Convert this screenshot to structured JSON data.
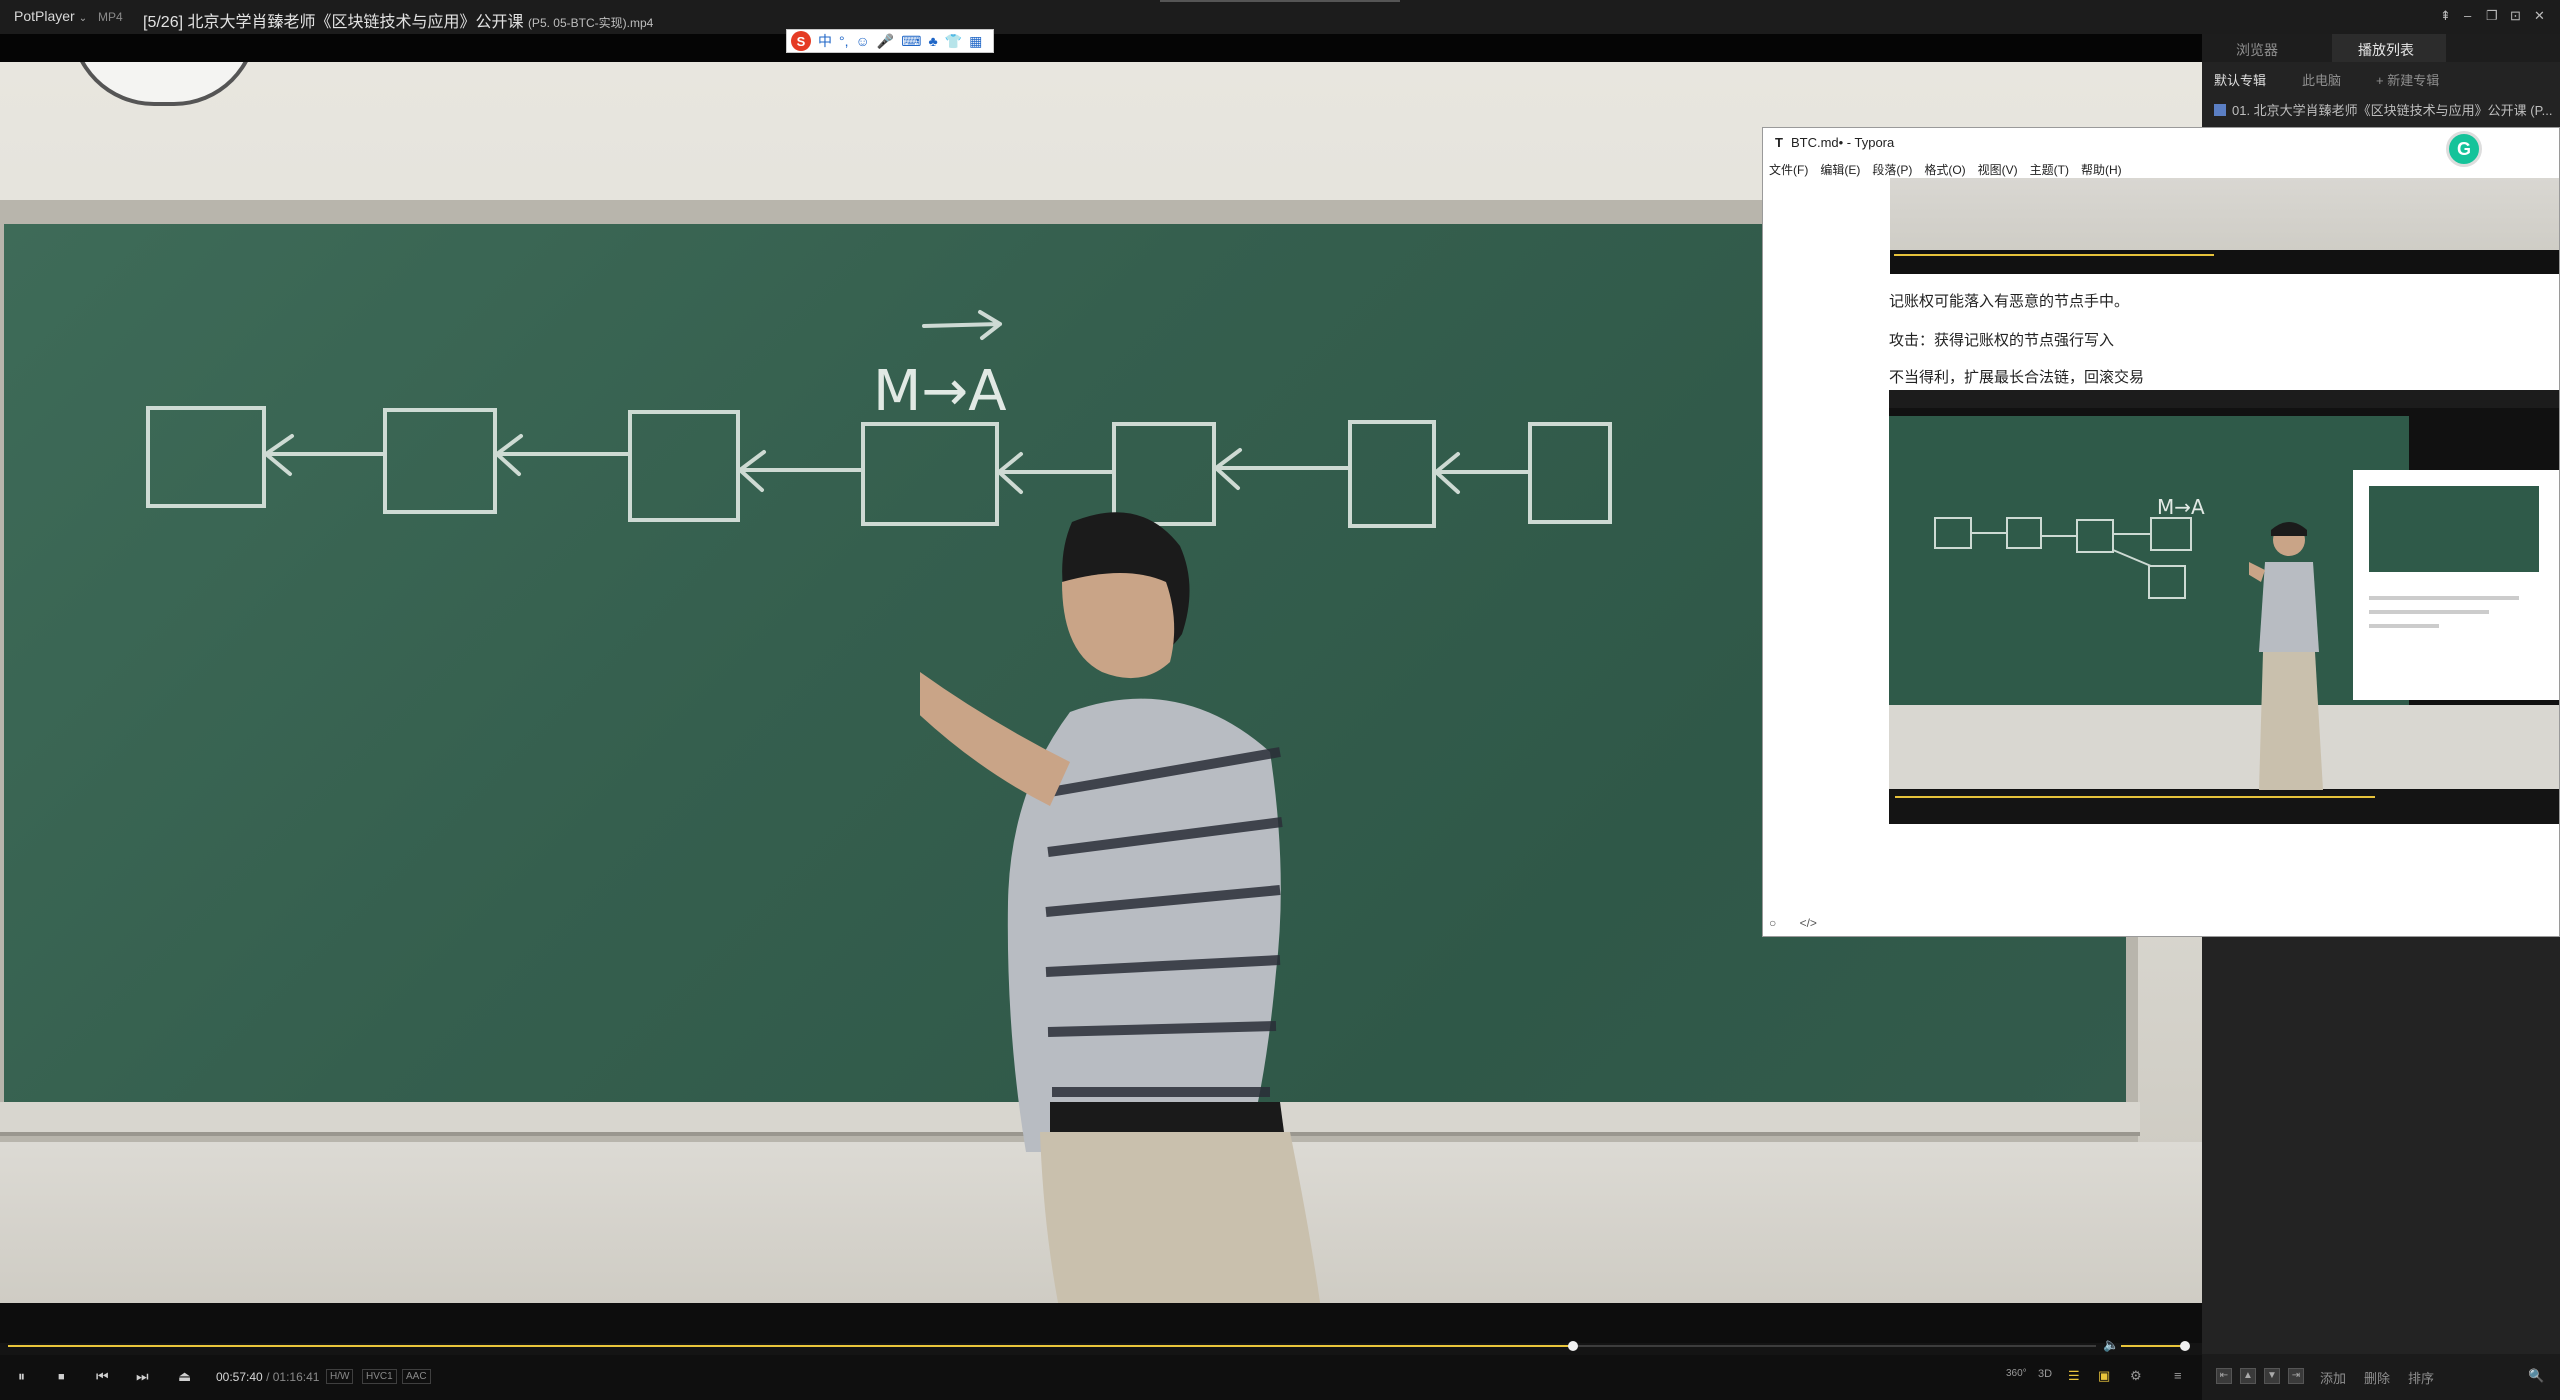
{
  "player": {
    "brand": "PotPlayer",
    "brand_caret": "⌄",
    "format": "MP4",
    "title": "[5/26] 北京大学肖臻老师《区块链技术与应用》公开课",
    "title_sub": "(P5. 05-BTC-实现).mp4",
    "window_controls": [
      "⇞",
      "–",
      "❐",
      "⊡",
      "✕"
    ]
  },
  "ime": {
    "logo": "S",
    "items": [
      "中",
      "°,",
      "☺",
      "🎤",
      "⌨",
      "♣",
      "👕",
      "▦"
    ]
  },
  "video": {
    "board_text": "M→A"
  },
  "typora": {
    "icon": "T",
    "title": "BTC.md• - Typora",
    "menu": [
      "文件(F)",
      "编辑(E)",
      "段落(P)",
      "格式(O)",
      "视图(V)",
      "主题(T)",
      "帮助(H)"
    ],
    "grammarly": "G",
    "lines": [
      "记账权可能落入有恶意的节点手中。",
      "攻击：获得记账权的节点强行写入",
      "不当得利，扩展最长合法链，回滚交易"
    ],
    "thumb_board_text": "M→A",
    "footer_icons": [
      "○",
      "</>"
    ]
  },
  "sidebar": {
    "tabs": [
      "浏览器",
      "播放列表"
    ],
    "albums": [
      "默认专辑",
      "此电脑",
      "+ 新建专辑"
    ],
    "playlist": [
      "01. 北京大学肖臻老师《区块链技术与应用》公开课 (P..."
    ],
    "bottom_buttons": [
      "添加",
      "删除",
      "排序"
    ],
    "bottom_icons": [
      "⇤",
      "▲",
      "▼",
      "⇥"
    ],
    "search_icon": "🔍"
  },
  "controls": {
    "progress": 0.7494,
    "volume": 0.97,
    "current_time": "00:57:40",
    "separator": "/",
    "total_time": "01:16:41",
    "badges": [
      "H/W",
      "HVC1",
      "AAC"
    ],
    "buttons": {
      "pause": "⏸",
      "stop": "■",
      "prev": "⏮",
      "next": "⏭",
      "eject": "⏏"
    },
    "right_tools": [
      "360°",
      "3D",
      "☰",
      "▣",
      "⚙",
      "≡"
    ]
  },
  "colors": {
    "accent": "#e9c53b",
    "chalkboard": "#355f4e",
    "panel": "#232323"
  }
}
